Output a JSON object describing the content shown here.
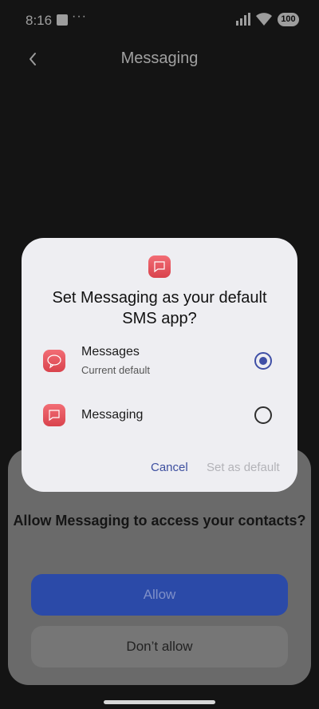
{
  "status_bar": {
    "time": "8:16",
    "dots": "···",
    "battery": "100"
  },
  "header": {
    "title": "Messaging"
  },
  "permission_sheet": {
    "title": "Allow Messaging to access your contacts?",
    "allow_label": "Allow",
    "deny_label": "Don’t allow"
  },
  "dialog": {
    "title": "Set Messaging as your default SMS app?",
    "options": [
      {
        "label": "Messages",
        "sublabel": "Current default",
        "selected": true
      },
      {
        "label": "Messaging",
        "sublabel": "",
        "selected": false
      }
    ],
    "cancel_label": "Cancel",
    "set_default_label": "Set as default"
  },
  "colors": {
    "accent": "#3f4fa6",
    "app_icon": "#e2525b"
  }
}
